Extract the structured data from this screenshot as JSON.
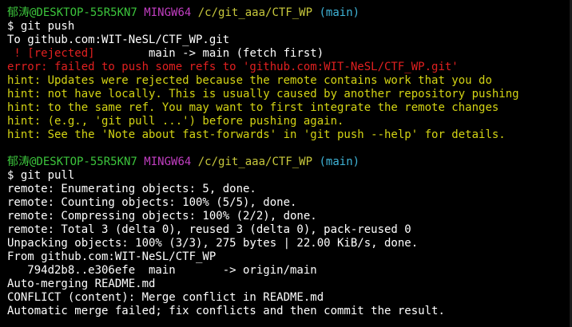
{
  "prompt1": {
    "user": "郁涛@DESKTOP-55R5KN7",
    "msys": "MINGW64",
    "path": "/c/git_aaa/CTF_WP",
    "branch": "(main)",
    "command": "$ git push"
  },
  "push_output": {
    "to_line": "To github.com:WIT-NeSL/CTF_WP.git",
    "rejected_tag": " ! [rejected]",
    "rejected_rest": "        main -> main (fetch first)",
    "error_line": "error: failed to push some refs to 'github.com:WIT-NeSL/CTF_WP.git'",
    "hints": [
      "hint: Updates were rejected because the remote contains work that you do",
      "hint: not have locally. This is usually caused by another repository pushing",
      "hint: to the same ref. You may want to first integrate the remote changes",
      "hint: (e.g., 'git pull ...') before pushing again.",
      "hint: See the 'Note about fast-forwards' in 'git push --help' for details."
    ]
  },
  "prompt2": {
    "user": "郁涛@DESKTOP-55R5KN7",
    "msys": "MINGW64",
    "path": "/c/git_aaa/CTF_WP",
    "branch": "(main)",
    "command": "$ git pull"
  },
  "pull_output": [
    "remote: Enumerating objects: 5, done.",
    "remote: Counting objects: 100% (5/5), done.",
    "remote: Compressing objects: 100% (2/2), done.",
    "remote: Total 3 (delta 0), reused 3 (delta 0), pack-reused 0",
    "Unpacking objects: 100% (3/3), 275 bytes | 22.00 KiB/s, done.",
    "From github.com:WIT-NeSL/CTF_WP",
    "   794d2b8..e306efe  main       -> origin/main",
    "Auto-merging README.md",
    "CONFLICT (content): Merge conflict in README.md",
    "Automatic merge failed; fix conflicts and then commit the result."
  ],
  "colors": {
    "background": "#000000",
    "user": "#3cc43c",
    "msys": "#c13ec1",
    "path": "#c8c83c",
    "branch": "#3fb4d8",
    "error": "#e02020",
    "hint": "#d4d414",
    "text": "#ffffff"
  }
}
